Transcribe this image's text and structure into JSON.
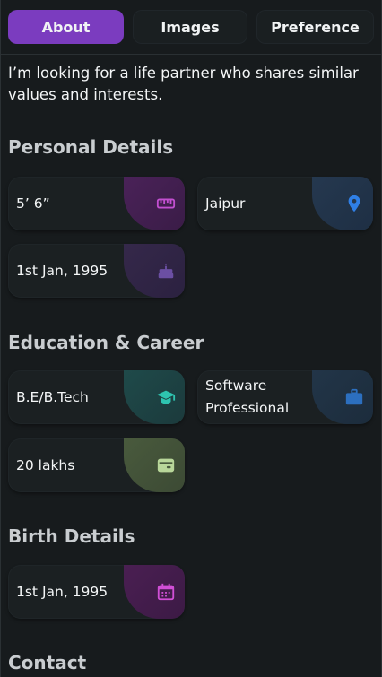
{
  "tabs": [
    {
      "label": "About",
      "active": true
    },
    {
      "label": "Images",
      "active": false
    },
    {
      "label": "Preference",
      "active": false
    }
  ],
  "about_text": "I’m looking for a life partner who shares similar values and interests.",
  "sections": {
    "personal": {
      "title": "Personal Details",
      "items": [
        {
          "label": "5’ 6”",
          "icon": "ruler-icon",
          "color": "#c24fd0"
        },
        {
          "label": "Jaipur",
          "icon": "location-pin-icon",
          "color": "#2f7fe6"
        },
        {
          "label": "1st Jan, 1995",
          "icon": "birthday-cake-icon",
          "color": "#6b4fa3"
        }
      ]
    },
    "education": {
      "title": "Education & Career",
      "items": [
        {
          "label": "B.E/B.Tech",
          "icon": "graduation-cap-icon",
          "color": "#2ec4b0"
        },
        {
          "label": "Software Professional",
          "icon": "briefcase-icon",
          "color": "#2c6fbf"
        },
        {
          "label": "20 lakhs",
          "icon": "wallet-icon",
          "color": "#b9d79a"
        }
      ]
    },
    "birth": {
      "title": "Birth Details",
      "items": [
        {
          "label": "1st Jan, 1995",
          "icon": "calendar-icon",
          "color": "#d14fd6"
        }
      ]
    },
    "contact": {
      "title": "Contact"
    }
  },
  "colors": {
    "background": "#171b1d",
    "card": "#1b2022",
    "accent": "#7b3cbf"
  }
}
